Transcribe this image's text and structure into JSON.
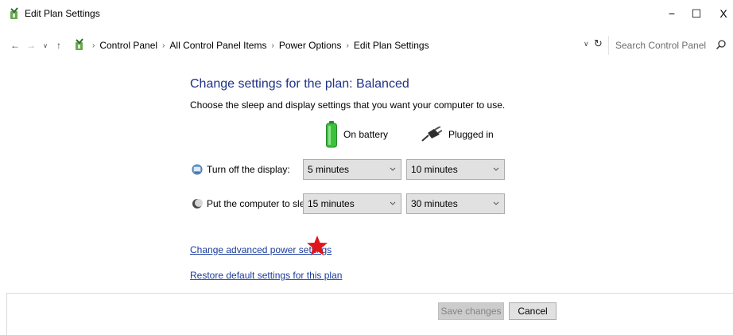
{
  "window": {
    "title": "Edit Plan Settings",
    "minimize_glyph": "−",
    "maximize_glyph": "☐",
    "close_glyph": "X",
    "app_icon": "power-options-icon"
  },
  "address_bar": {
    "back_glyph": "←",
    "forward_glyph": "→",
    "recent_glyph": "∨",
    "up_glyph": "↑",
    "breadcrumbs": [
      "Control Panel",
      "All Control Panel Items",
      "Power Options",
      "Edit Plan Settings"
    ],
    "separator": "›",
    "dropdown_glyph": "∨",
    "refresh_glyph": "↻",
    "search_placeholder": "Search Control Panel"
  },
  "plan": {
    "heading": "Change settings for the plan: Balanced",
    "description": "Choose the sleep and display settings that you want your computer to use."
  },
  "columns": {
    "on_battery": "On battery",
    "plugged_in": "Plugged in"
  },
  "settings": [
    {
      "label": "Turn off the display:",
      "icon": "display-icon",
      "on_battery": "5 minutes",
      "plugged_in": "10 minutes"
    },
    {
      "label": "Put the computer to sleep:",
      "icon": "sleep-moon-icon",
      "on_battery": "15 minutes",
      "plugged_in": "30 minutes"
    }
  ],
  "links": {
    "advanced": "Change advanced power settings",
    "restore": "Restore default settings for this plan"
  },
  "buttons": {
    "save": "Save changes",
    "cancel": "Cancel"
  },
  "colors": {
    "heading": "#1e3287",
    "link": "#1a3b9c",
    "annotation_star": "#e0161c",
    "battery_green": "#3cc13c"
  }
}
